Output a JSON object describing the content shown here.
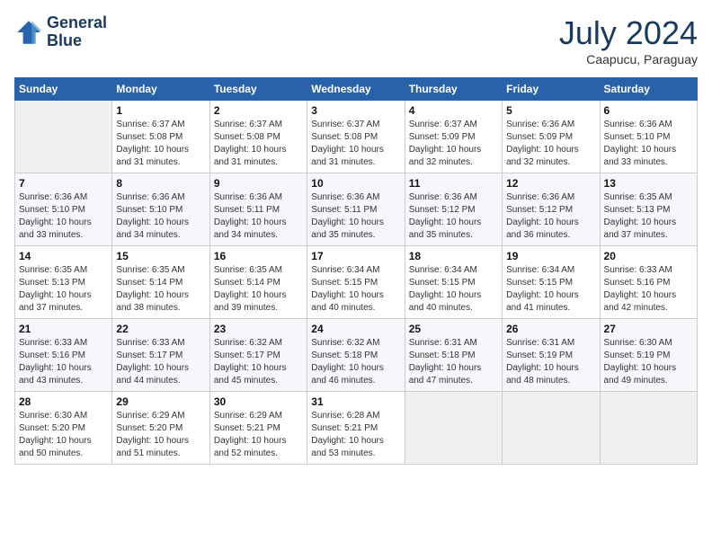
{
  "header": {
    "logo_line1": "General",
    "logo_line2": "Blue",
    "month_title": "July 2024",
    "subtitle": "Caapucu, Paraguay"
  },
  "weekdays": [
    "Sunday",
    "Monday",
    "Tuesday",
    "Wednesday",
    "Thursday",
    "Friday",
    "Saturday"
  ],
  "weeks": [
    [
      {
        "day": "",
        "sunrise": "",
        "sunset": "",
        "daylight": ""
      },
      {
        "day": "1",
        "sunrise": "Sunrise: 6:37 AM",
        "sunset": "Sunset: 5:08 PM",
        "daylight": "Daylight: 10 hours and 31 minutes."
      },
      {
        "day": "2",
        "sunrise": "Sunrise: 6:37 AM",
        "sunset": "Sunset: 5:08 PM",
        "daylight": "Daylight: 10 hours and 31 minutes."
      },
      {
        "day": "3",
        "sunrise": "Sunrise: 6:37 AM",
        "sunset": "Sunset: 5:08 PM",
        "daylight": "Daylight: 10 hours and 31 minutes."
      },
      {
        "day": "4",
        "sunrise": "Sunrise: 6:37 AM",
        "sunset": "Sunset: 5:09 PM",
        "daylight": "Daylight: 10 hours and 32 minutes."
      },
      {
        "day": "5",
        "sunrise": "Sunrise: 6:36 AM",
        "sunset": "Sunset: 5:09 PM",
        "daylight": "Daylight: 10 hours and 32 minutes."
      },
      {
        "day": "6",
        "sunrise": "Sunrise: 6:36 AM",
        "sunset": "Sunset: 5:10 PM",
        "daylight": "Daylight: 10 hours and 33 minutes."
      }
    ],
    [
      {
        "day": "7",
        "sunrise": "Sunrise: 6:36 AM",
        "sunset": "Sunset: 5:10 PM",
        "daylight": "Daylight: 10 hours and 33 minutes."
      },
      {
        "day": "8",
        "sunrise": "Sunrise: 6:36 AM",
        "sunset": "Sunset: 5:10 PM",
        "daylight": "Daylight: 10 hours and 34 minutes."
      },
      {
        "day": "9",
        "sunrise": "Sunrise: 6:36 AM",
        "sunset": "Sunset: 5:11 PM",
        "daylight": "Daylight: 10 hours and 34 minutes."
      },
      {
        "day": "10",
        "sunrise": "Sunrise: 6:36 AM",
        "sunset": "Sunset: 5:11 PM",
        "daylight": "Daylight: 10 hours and 35 minutes."
      },
      {
        "day": "11",
        "sunrise": "Sunrise: 6:36 AM",
        "sunset": "Sunset: 5:12 PM",
        "daylight": "Daylight: 10 hours and 35 minutes."
      },
      {
        "day": "12",
        "sunrise": "Sunrise: 6:36 AM",
        "sunset": "Sunset: 5:12 PM",
        "daylight": "Daylight: 10 hours and 36 minutes."
      },
      {
        "day": "13",
        "sunrise": "Sunrise: 6:35 AM",
        "sunset": "Sunset: 5:13 PM",
        "daylight": "Daylight: 10 hours and 37 minutes."
      }
    ],
    [
      {
        "day": "14",
        "sunrise": "Sunrise: 6:35 AM",
        "sunset": "Sunset: 5:13 PM",
        "daylight": "Daylight: 10 hours and 37 minutes."
      },
      {
        "day": "15",
        "sunrise": "Sunrise: 6:35 AM",
        "sunset": "Sunset: 5:14 PM",
        "daylight": "Daylight: 10 hours and 38 minutes."
      },
      {
        "day": "16",
        "sunrise": "Sunrise: 6:35 AM",
        "sunset": "Sunset: 5:14 PM",
        "daylight": "Daylight: 10 hours and 39 minutes."
      },
      {
        "day": "17",
        "sunrise": "Sunrise: 6:34 AM",
        "sunset": "Sunset: 5:15 PM",
        "daylight": "Daylight: 10 hours and 40 minutes."
      },
      {
        "day": "18",
        "sunrise": "Sunrise: 6:34 AM",
        "sunset": "Sunset: 5:15 PM",
        "daylight": "Daylight: 10 hours and 40 minutes."
      },
      {
        "day": "19",
        "sunrise": "Sunrise: 6:34 AM",
        "sunset": "Sunset: 5:15 PM",
        "daylight": "Daylight: 10 hours and 41 minutes."
      },
      {
        "day": "20",
        "sunrise": "Sunrise: 6:33 AM",
        "sunset": "Sunset: 5:16 PM",
        "daylight": "Daylight: 10 hours and 42 minutes."
      }
    ],
    [
      {
        "day": "21",
        "sunrise": "Sunrise: 6:33 AM",
        "sunset": "Sunset: 5:16 PM",
        "daylight": "Daylight: 10 hours and 43 minutes."
      },
      {
        "day": "22",
        "sunrise": "Sunrise: 6:33 AM",
        "sunset": "Sunset: 5:17 PM",
        "daylight": "Daylight: 10 hours and 44 minutes."
      },
      {
        "day": "23",
        "sunrise": "Sunrise: 6:32 AM",
        "sunset": "Sunset: 5:17 PM",
        "daylight": "Daylight: 10 hours and 45 minutes."
      },
      {
        "day": "24",
        "sunrise": "Sunrise: 6:32 AM",
        "sunset": "Sunset: 5:18 PM",
        "daylight": "Daylight: 10 hours and 46 minutes."
      },
      {
        "day": "25",
        "sunrise": "Sunrise: 6:31 AM",
        "sunset": "Sunset: 5:18 PM",
        "daylight": "Daylight: 10 hours and 47 minutes."
      },
      {
        "day": "26",
        "sunrise": "Sunrise: 6:31 AM",
        "sunset": "Sunset: 5:19 PM",
        "daylight": "Daylight: 10 hours and 48 minutes."
      },
      {
        "day": "27",
        "sunrise": "Sunrise: 6:30 AM",
        "sunset": "Sunset: 5:19 PM",
        "daylight": "Daylight: 10 hours and 49 minutes."
      }
    ],
    [
      {
        "day": "28",
        "sunrise": "Sunrise: 6:30 AM",
        "sunset": "Sunset: 5:20 PM",
        "daylight": "Daylight: 10 hours and 50 minutes."
      },
      {
        "day": "29",
        "sunrise": "Sunrise: 6:29 AM",
        "sunset": "Sunset: 5:20 PM",
        "daylight": "Daylight: 10 hours and 51 minutes."
      },
      {
        "day": "30",
        "sunrise": "Sunrise: 6:29 AM",
        "sunset": "Sunset: 5:21 PM",
        "daylight": "Daylight: 10 hours and 52 minutes."
      },
      {
        "day": "31",
        "sunrise": "Sunrise: 6:28 AM",
        "sunset": "Sunset: 5:21 PM",
        "daylight": "Daylight: 10 hours and 53 minutes."
      },
      {
        "day": "",
        "sunrise": "",
        "sunset": "",
        "daylight": ""
      },
      {
        "day": "",
        "sunrise": "",
        "sunset": "",
        "daylight": ""
      },
      {
        "day": "",
        "sunrise": "",
        "sunset": "",
        "daylight": ""
      }
    ]
  ]
}
